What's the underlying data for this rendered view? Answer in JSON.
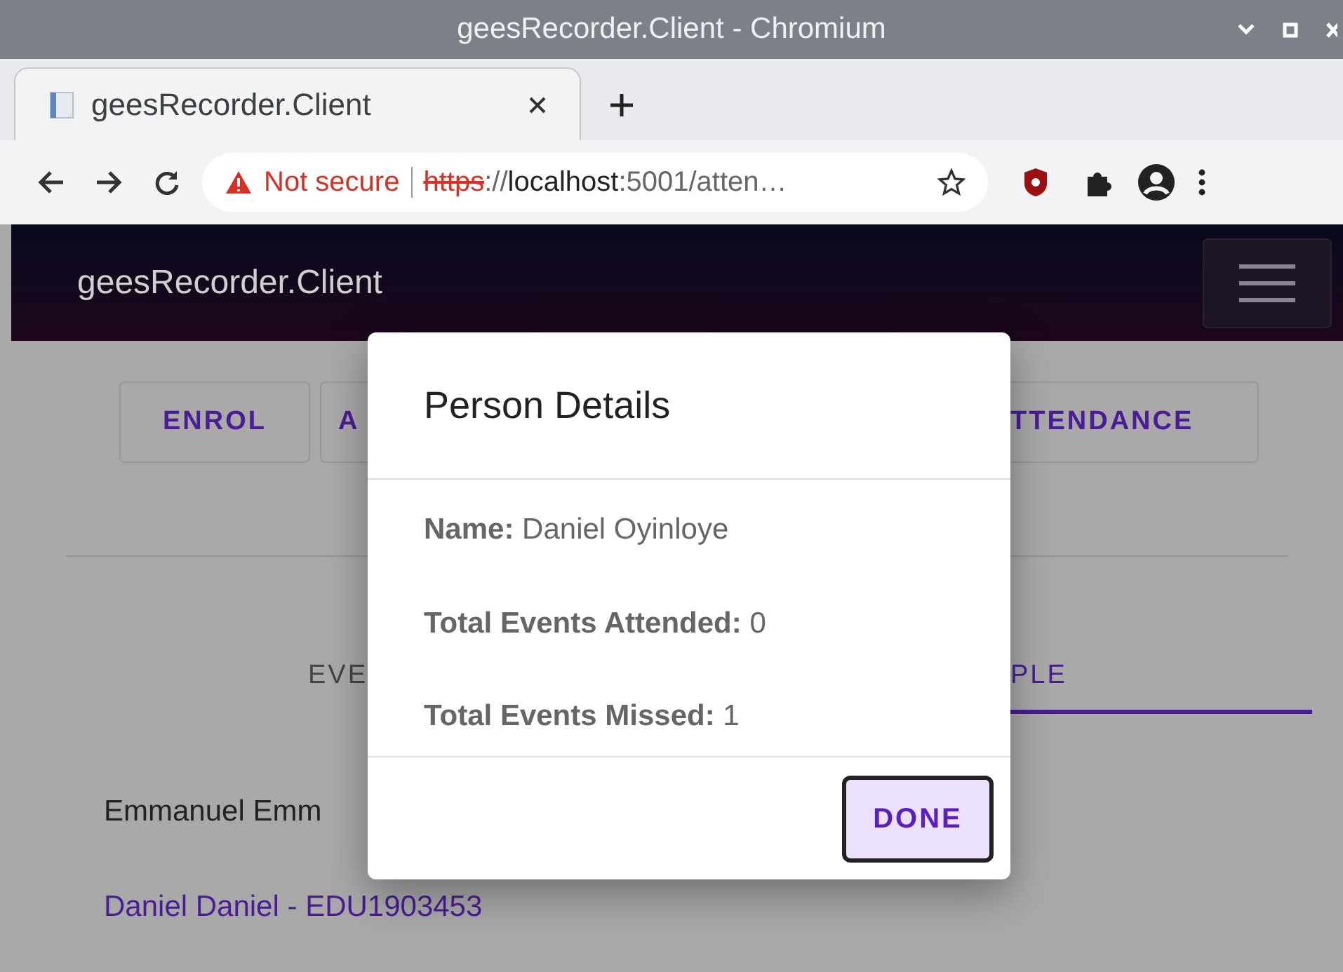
{
  "window": {
    "title": "geesRecorder.Client - Chromium"
  },
  "browser_tabs": [
    {
      "label": "geesRecorder.Client",
      "selected": true
    }
  ],
  "address_bar": {
    "security": "Not secure",
    "scheme": "https",
    "separator": "://",
    "host": "localhost",
    "path": ":5001/atten…"
  },
  "navbar": {
    "brand": "geesRecorder.Client"
  },
  "action_buttons": [
    "ENROL",
    "A",
    "TTENDANCE"
  ],
  "view_tabs": [
    {
      "label": "EVE",
      "selected": false
    },
    {
      "label": "PLE",
      "selected": true
    }
  ],
  "people": [
    {
      "text": "Emmanuel Emm",
      "kind": "plain"
    },
    {
      "text": "Daniel Daniel - EDU1903453",
      "kind": "link"
    }
  ],
  "dialog": {
    "title": "Person Details",
    "fields": [
      {
        "label": "Name:",
        "value": "Daniel Oyinloye"
      },
      {
        "label": "Total Events Attended:",
        "value": "0"
      },
      {
        "label": "Total Events Missed:",
        "value": "1"
      }
    ],
    "done": "DONE"
  }
}
